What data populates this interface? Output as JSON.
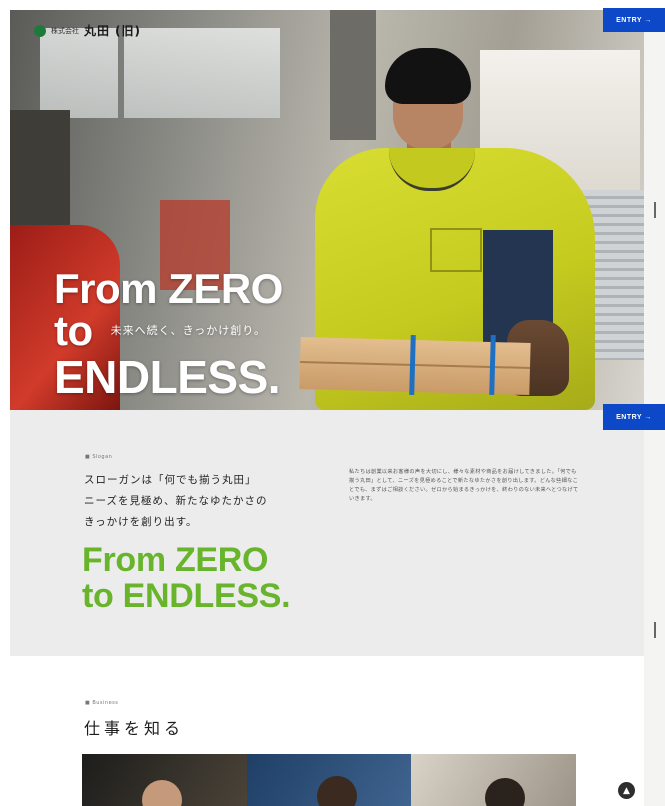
{
  "header": {
    "logo_prefix": "株式会社",
    "logo_name": "丸田",
    "logo_suffix": "(旧)",
    "entry_label": "ENTRY →"
  },
  "hero": {
    "line1": "From ZERO",
    "line2": "to",
    "tagline": "未来へ続く、きっかけ創り。",
    "line3": "ENDLESS."
  },
  "slogan": {
    "eyebrow": "■ Slogan",
    "lead": [
      "スローガンは「何でも揃う丸田」",
      "ニーズを見極め、新たなゆたかさの",
      "きっかけを創り出す。"
    ],
    "headline_line1": "From ZERO",
    "headline_line2": "to ENDLESS.",
    "body": "私たちは創業以来お客様の声を大切にし、様々な素材や商品をお届けしてきました。「何でも揃う丸田」として、ニーズを見極めることで新たなゆたかさを創り出します。どんな些細なことでも、まずはご相談ください。ゼロから始まるきっかけを、終わりのない未来へとつなげていきます。"
  },
  "work": {
    "eyebrow": "■ Business",
    "title": "仕事を知る"
  },
  "colors": {
    "accent_green": "#68b52c",
    "entry_blue": "#0d48c9"
  },
  "icons": {
    "scroll_top": "chevron-up-icon"
  }
}
